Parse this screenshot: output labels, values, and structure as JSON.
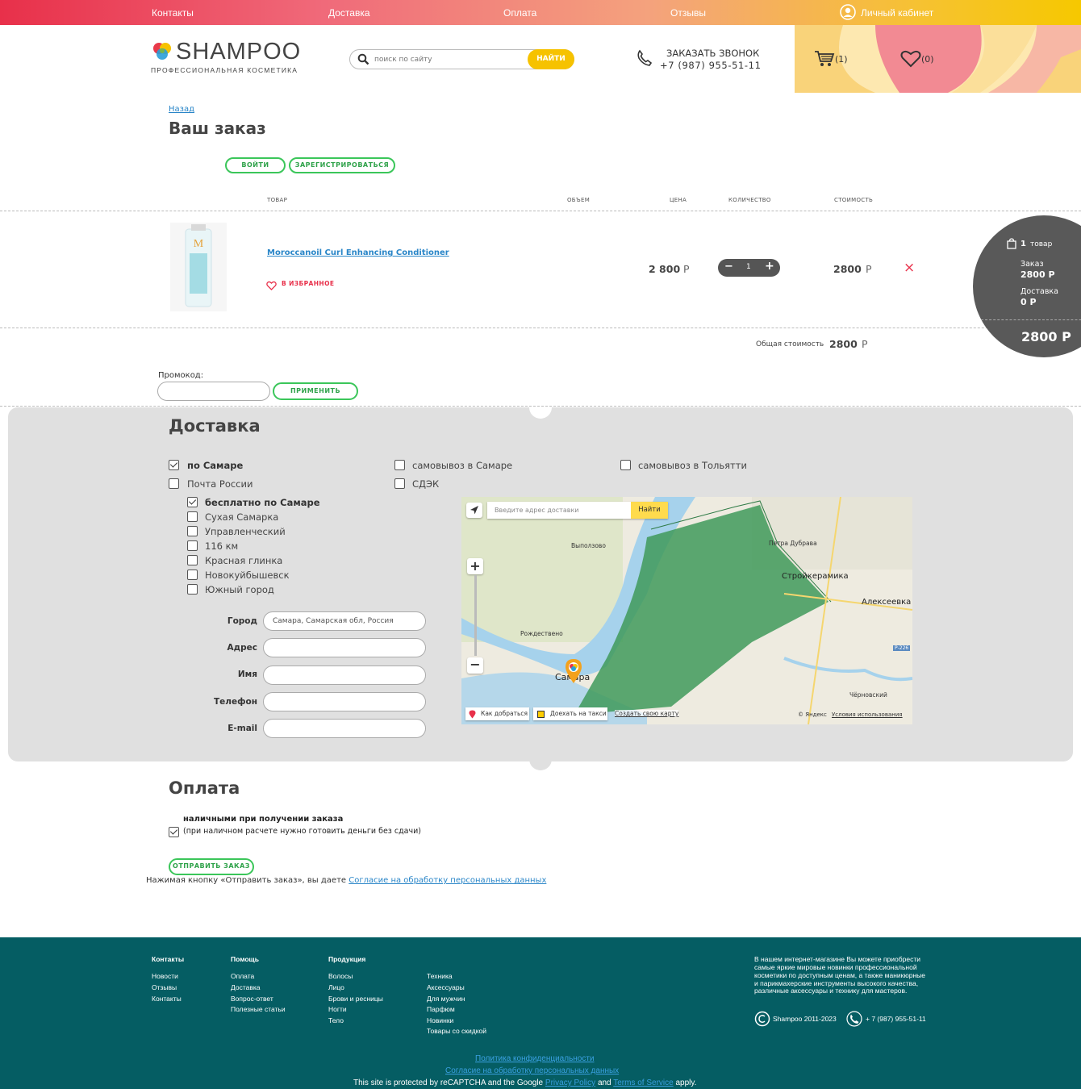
{
  "topnav": {
    "items": [
      "Контакты",
      "Доставка",
      "Оплата",
      "Отзывы"
    ],
    "account": "Личный кабинет"
  },
  "brand": {
    "name": "SHAMPOO",
    "tagline": "ПРОФЕССИОНАЛЬНАЯ КОСМЕТИКА"
  },
  "search": {
    "placeholder": "поиск по сайту",
    "button": "НАЙТИ"
  },
  "callback": {
    "title": "ЗАКАЗАТЬ ЗВОНОК",
    "phone": "+7 (987) 955-51-11"
  },
  "header_counts": {
    "cart": "(1)",
    "favorites": "(0)"
  },
  "order": {
    "back": "Назад",
    "title": "Ваш заказ",
    "login": "ВОЙТИ",
    "register": "ЗАРЕГИСТРИРОВАТЬСЯ",
    "columns": [
      "ТОВАР",
      "ОБЪЕМ",
      "ЦЕНА",
      "КОЛИЧЕСТВО",
      "СТОИМОСТЬ"
    ],
    "item": {
      "name": "Moroccanoil Curl Enhancing Conditioner",
      "favorite": "В ИЗБРАННОЕ",
      "price": "2 800",
      "currency": "Р",
      "qty": "1",
      "minus": "−",
      "plus": "+",
      "cost": "2800",
      "remove": "×"
    },
    "total_label": "Общая стоимость",
    "total_value": "2800",
    "promo_label": "Промокод:",
    "promo_apply": "ПРИМЕНИТЬ"
  },
  "summary": {
    "count": "1",
    "count_label": "товар",
    "order_label": "Заказ",
    "order_value": "2800 Р",
    "delivery_label": "Доставка",
    "delivery_value": "0 Р",
    "total": "2800 Р"
  },
  "delivery": {
    "title": "Доставка",
    "options": [
      {
        "label": "по Самаре",
        "checked": true
      },
      {
        "label": "самовывоз в Самаре",
        "checked": false
      },
      {
        "label": "самовывоз в Тольятти",
        "checked": false
      },
      {
        "label": "Почта России",
        "checked": false
      },
      {
        "label": "СДЭК",
        "checked": false
      }
    ],
    "zones": [
      {
        "label": "бесплатно по Самаре",
        "checked": true
      },
      {
        "label": "Сухая Самарка",
        "checked": false
      },
      {
        "label": "Управленческий",
        "checked": false
      },
      {
        "label": "116 км",
        "checked": false
      },
      {
        "label": "Красная глинка",
        "checked": false
      },
      {
        "label": "Новокуйбышевск",
        "checked": false
      },
      {
        "label": "Южный город",
        "checked": false
      }
    ],
    "fields": {
      "city_label": "Город",
      "city_value": "Самара, Самарская обл, Россия",
      "address_label": "Адрес",
      "name_label": "Имя",
      "phone_label": "Телефон",
      "email_label": "E-mail"
    }
  },
  "map": {
    "address_placeholder": "Введите адрес доставки",
    "find": "Найти",
    "places": [
      "Выползово",
      "Петра Дубрава",
      "Стройкерамика",
      "Алексеевка",
      "Рождествено",
      "Самара",
      "Чёрновский",
      "Р-226"
    ],
    "route": "Как добраться",
    "taxi": "Доехать на такси",
    "create": "Создать свою карту",
    "copyright": "© Яндекс",
    "terms": "Условия использования"
  },
  "payment": {
    "title": "Оплата",
    "method": "наличными при получении заказа",
    "note": "(при наличном расчете нужно готовить деньги без сдачи)",
    "submit": "ОТПРАВИТЬ ЗАКАЗ",
    "consent_prefix": "Нажимая кнопку «Отправить заказ», вы даете",
    "consent_link": "Согласие на обработку персональных данных"
  },
  "footer": {
    "col1": {
      "title": "Контакты",
      "items": [
        "Новости",
        "Отзывы",
        "Контакты"
      ]
    },
    "col2": {
      "title": "Помощь",
      "items": [
        "Оплата",
        "Доставка",
        "Вопрос-ответ",
        "Полезные статьи"
      ]
    },
    "col3": {
      "title": "Продукция",
      "items": [
        "Волосы",
        "Лицо",
        "Брови и ресницы",
        "Ногти",
        "Тело"
      ]
    },
    "col4": {
      "items": [
        "Техника",
        "Аксессуары",
        "Для мужчин",
        "Парфюм",
        "Новинки",
        "Товары со скидкой"
      ]
    },
    "about": [
      "В нашем интернет-магазине Вы можете приобрести",
      "самые яркие мировые новинки профессиональной",
      "косметики по доступным ценам, а также маникюрные",
      "и парикмахерские инструменты высокого качества,",
      "различные аксессуары и технику для мастеров."
    ],
    "copyright": "Shampoo 2011-2023",
    "phone": "+ 7 (987) 955-51-11",
    "privacy": "Политика конфиденциальности",
    "consent": "Согласие на обработку персональных данных",
    "recaptcha_prefix": "This site is protected by reCAPTCHA and the Google",
    "privacy_policy": "Privacy Policy",
    "and": "and",
    "terms": "Terms of Service",
    "apply": "apply."
  },
  "colors": {
    "accent_green": "#3bc65a",
    "accent_yellow": "#f6c200",
    "footer_bg": "#055d63",
    "zone_green": "#3f9a5a",
    "summary_bg": "#595959"
  }
}
